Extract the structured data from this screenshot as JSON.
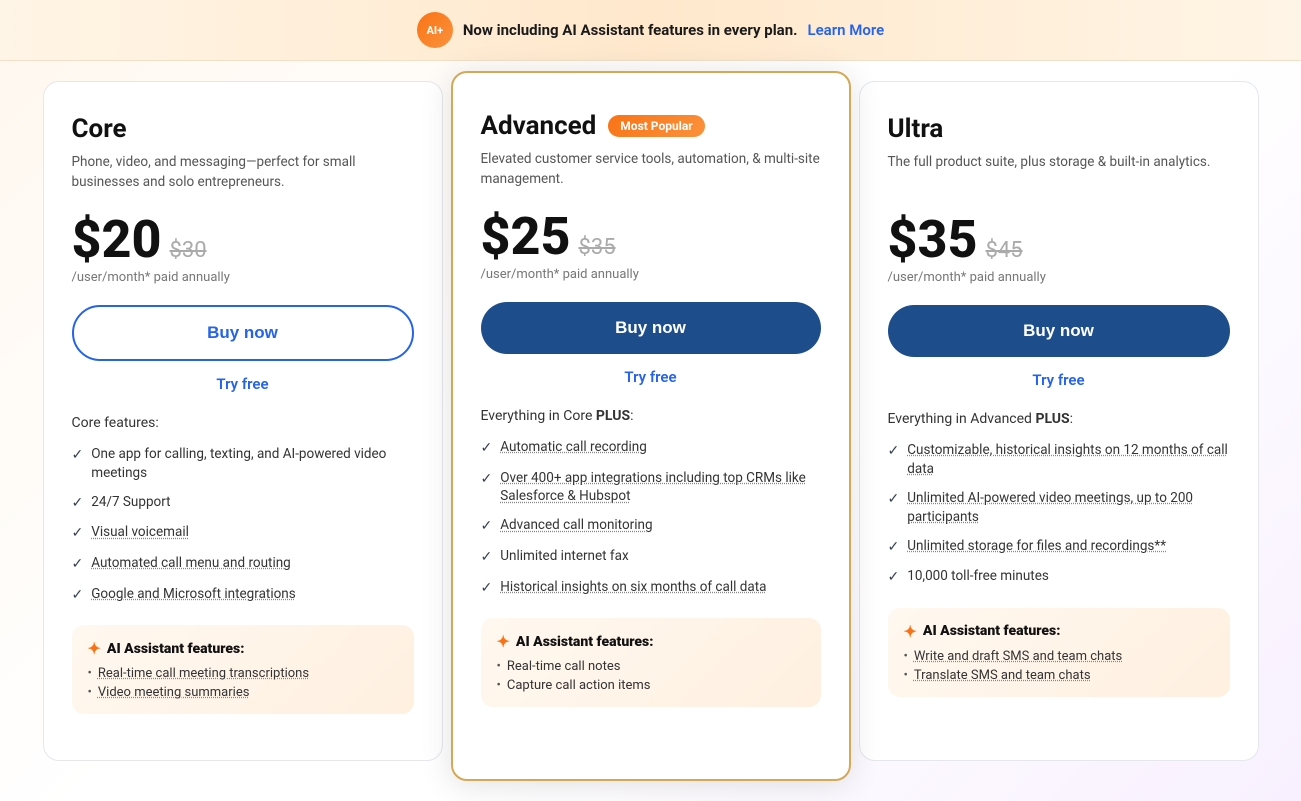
{
  "banner": {
    "badge_text": "AI+",
    "message": "Now including AI Assistant features in every plan.",
    "link_text": "Learn More"
  },
  "plans": [
    {
      "id": "core",
      "title": "Core",
      "most_popular": false,
      "description": "Phone, video, and messaging—perfect for small businesses and solo entrepreneurs.",
      "price_current": "$20",
      "price_original": "$30",
      "price_period": "/user/month* paid annually",
      "buy_label": "Buy now",
      "buy_style": "outline",
      "try_label": "Try free",
      "features_intro": "Core features:",
      "features_intro_bold": "",
      "features": [
        "One app for calling, texting, and AI-powered video meetings",
        "24/7 Support",
        "Visual voicemail",
        "Automated call menu and routing",
        "Google and Microsoft integrations"
      ],
      "features_linked": [
        false,
        false,
        true,
        true,
        true
      ],
      "ai_section": {
        "title": "AI Assistant features:",
        "items": [
          "Real-time call meeting transcriptions",
          "Video meeting summaries"
        ],
        "items_linked": [
          true,
          true
        ]
      }
    },
    {
      "id": "advanced",
      "title": "Advanced",
      "most_popular": true,
      "most_popular_label": "Most Popular",
      "description": "Elevated customer service tools, automation, & multi-site management.",
      "price_current": "$25",
      "price_original": "$35",
      "price_period": "/user/month* paid annually",
      "buy_label": "Buy now",
      "buy_style": "filled",
      "try_label": "Try free",
      "features_intro": "Everything in Core ",
      "features_intro_bold": "PLUS",
      "features_intro_suffix": ":",
      "features": [
        "Automatic call recording",
        "Over 400+ app integrations including top CRMs like Salesforce & Hubspot",
        "Advanced call monitoring",
        "Unlimited internet fax",
        "Historical insights on six months of call data"
      ],
      "features_linked": [
        true,
        true,
        true,
        false,
        true
      ],
      "ai_section": {
        "title": "AI Assistant features:",
        "items": [
          "Real-time call notes",
          "Capture call action items"
        ],
        "items_linked": [
          false,
          false
        ]
      }
    },
    {
      "id": "ultra",
      "title": "Ultra",
      "most_popular": false,
      "description": "The full product suite, plus storage & built-in analytics.",
      "price_current": "$35",
      "price_original": "$45",
      "price_period": "/user/month* paid annually",
      "buy_label": "Buy now",
      "buy_style": "filled",
      "try_label": "Try free",
      "features_intro": "Everything in Advanced ",
      "features_intro_bold": "PLUS",
      "features_intro_suffix": ":",
      "features": [
        "Customizable, historical insights on 12 months of call data",
        "Unlimited AI-powered video meetings, up to 200 participants",
        "Unlimited storage for files and recordings**",
        "10,000 toll-free minutes"
      ],
      "features_linked": [
        true,
        true,
        true,
        false
      ],
      "ai_section": {
        "title": "AI Assistant features:",
        "items": [
          "Write and draft SMS and team chats",
          "Translate SMS and team chats"
        ],
        "items_linked": [
          true,
          true
        ]
      }
    }
  ]
}
